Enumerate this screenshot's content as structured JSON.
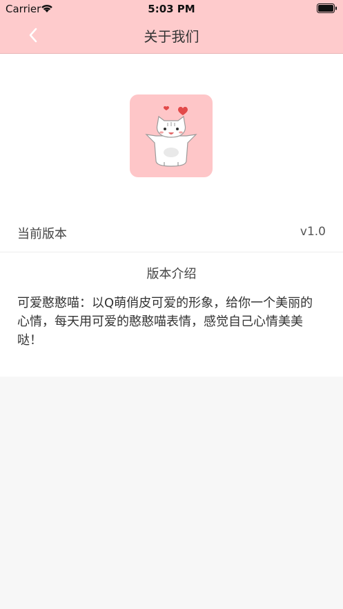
{
  "status_bar": {
    "carrier": "Carrier",
    "time": "5:03 PM"
  },
  "nav": {
    "title": "关于我们",
    "back_icon": "chevron-left-icon"
  },
  "app_icon": {
    "icon": "cat-mascot-icon",
    "background": "#fec6c8"
  },
  "version_row": {
    "label": "当前版本",
    "value": "v1.0"
  },
  "intro": {
    "title": "版本介绍",
    "text": "可爱憨憨喵：以Q萌俏皮可爱的形象，给你一个美丽的心情，每天用可爱的憨憨喵表情，感觉自己心情美美哒！"
  },
  "colors": {
    "header": "#fecbcc",
    "content_bg": "#ffffff",
    "page_bg": "#f7f7f7"
  }
}
